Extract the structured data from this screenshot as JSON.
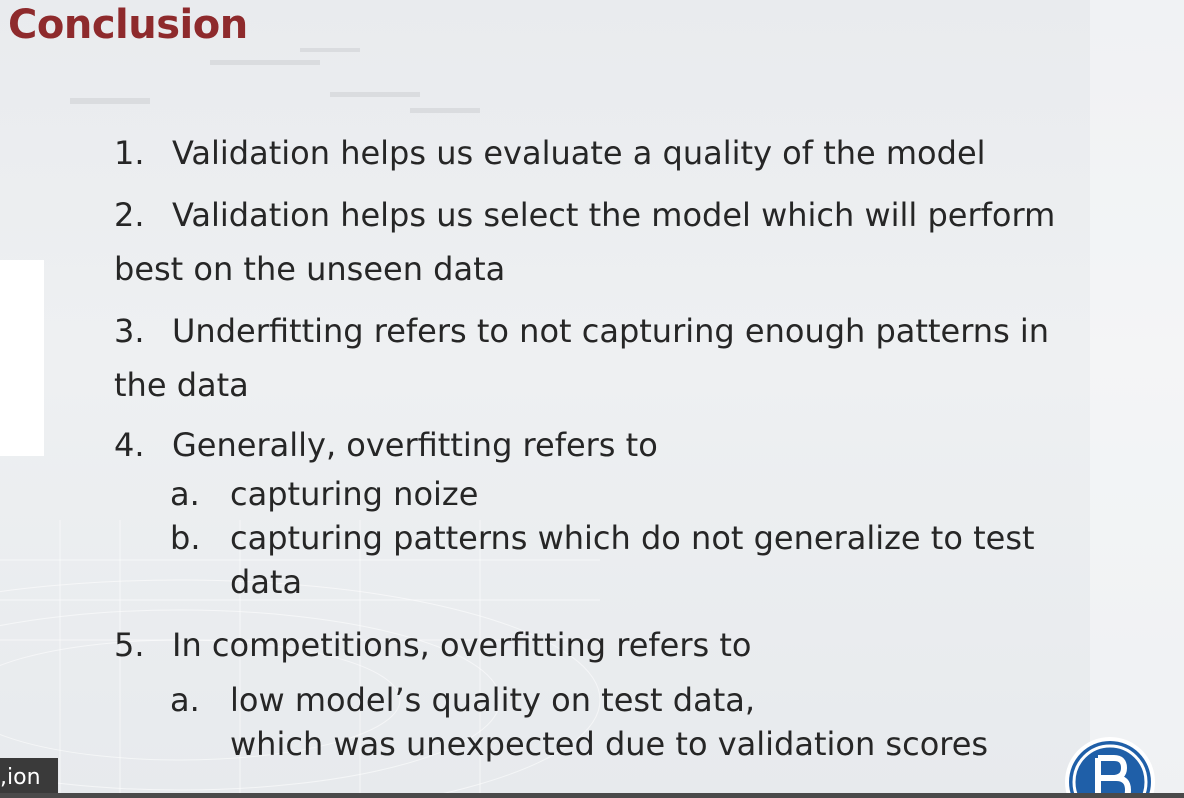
{
  "slide": {
    "title": "Conclusion",
    "items": [
      {
        "number": "1.",
        "text": "Validation helps us evaluate a quality of the model"
      },
      {
        "number": "2.",
        "text": "Validation helps us select the model which will perform",
        "continuation": "best on the unseen data"
      },
      {
        "number": "3.",
        "text": "Underfitting refers to not capturing enough patterns in",
        "continuation": "the data"
      },
      {
        "number": "4.",
        "text": "Generally, overfitting refers to",
        "subitems": [
          {
            "letter": "a.",
            "text": "capturing noize"
          },
          {
            "letter": "b.",
            "text": "capturing patterns which do not generalize to test",
            "continuation": "data"
          }
        ]
      },
      {
        "number": "5.",
        "text": "In competitions, overfitting refers to",
        "subitems": [
          {
            "letter": "a.",
            "text": "low model’s quality on test data,",
            "continuation": "which was unexpected due to validation scores"
          }
        ]
      }
    ]
  },
  "caption": {
    "text": "ion,"
  },
  "colors": {
    "title": "#8e2a2c",
    "text": "#262626",
    "logo": "#1f5fa8"
  },
  "icons": {
    "logo": "hse-logo-icon"
  }
}
